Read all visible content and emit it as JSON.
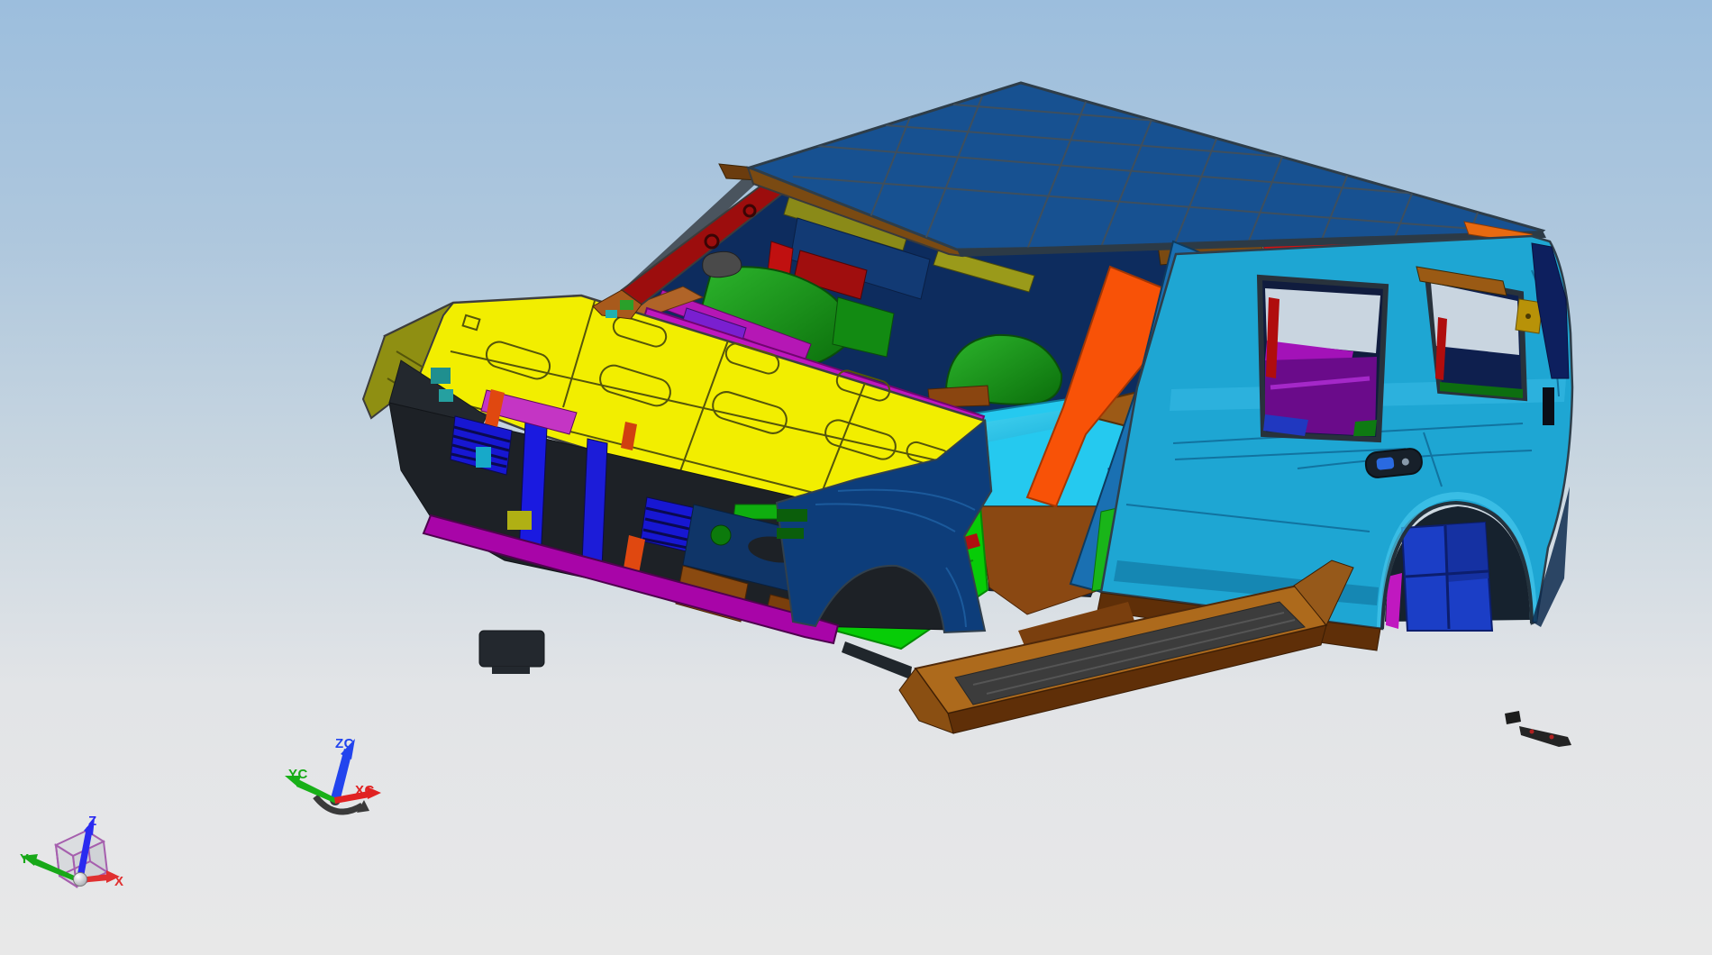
{
  "application": {
    "type": "cad-3d-viewport",
    "content": "Automotive body-in-white assembly shown in shaded view with per-part colors, isometric orientation"
  },
  "viewport": {
    "background_top": "#9cbedd",
    "background_middle": "#ccd8e1",
    "background_bottom": "#e8e8e8"
  },
  "wcs_triad": {
    "z": {
      "label": "ZC",
      "color": "#2244ee"
    },
    "y": {
      "label": "YC",
      "color": "#16a916"
    },
    "x": {
      "label": "XC",
      "color": "#e02222"
    },
    "handle_color": "#3a3a3a"
  },
  "absolute_triad": {
    "z": {
      "label": "Z",
      "color": "#2a2af0"
    },
    "y": {
      "label": "Y",
      "color": "#18a818"
    },
    "x": {
      "label": "X",
      "color": "#e03030"
    },
    "cube_edge_color": "#a65fae",
    "origin_ball_color": "#f0f0f4"
  },
  "model": {
    "assembly": "car-body-in-white",
    "palette": {
      "roof": "#175191",
      "hood": "#f2ee00",
      "body_side": "#1ea6d3",
      "header_rail": "#7a4a12",
      "running_board": "#ad6a1c",
      "floor_front": "#07cc07",
      "floor_mid": "#25c9ef",
      "floor_cargo": "#9c5a16",
      "front_fender_inner": "#0d3d7a",
      "grille": "#1717d2",
      "cowl_vent": "#bf16bf",
      "a_pillar_left": "#9c0d0d",
      "a_pillar_right": "#f85207",
      "b_pillar": "#1a70b2",
      "fender_edge_left": "#8f8f12",
      "bumper_rail": "#a805a8",
      "wheelhouse_green": "#1c9c1c",
      "arch_insert": "#1b3ec6",
      "window_glimpse": "#c9d5e0",
      "cargo_trim_purple": "#a312b8",
      "under_eave_red": "#d31111",
      "under_eave_cyan": "#29c3ef"
    },
    "parts": [
      {
        "name": "roof-panel",
        "color": "#175191"
      },
      {
        "name": "hood-panel",
        "color": "#f2ee00"
      },
      {
        "name": "body-side-outer",
        "color": "#1ea6d3"
      },
      {
        "name": "windshield-header-rail",
        "color": "#7a4a12"
      },
      {
        "name": "left-a-pillar-inner",
        "color": "#9c0d0d"
      },
      {
        "name": "right-a-pillar",
        "color": "#f85207"
      },
      {
        "name": "b-pillar-assembly",
        "color": "#1a70b2"
      },
      {
        "name": "front-floor-pan",
        "color": "#07cc07"
      },
      {
        "name": "mid-floor-pan",
        "color": "#25c9ef"
      },
      {
        "name": "cargo-floor",
        "color": "#9c5a16"
      },
      {
        "name": "front-fender-inner",
        "color": "#0d3d7a"
      },
      {
        "name": "grille-support",
        "color": "#1717d2"
      },
      {
        "name": "cowl-vent-panel",
        "color": "#bf16bf"
      },
      {
        "name": "bumper-lower-rail",
        "color": "#a805a8"
      },
      {
        "name": "running-board",
        "color": "#ad6a1c"
      },
      {
        "name": "left-fender-edge",
        "color": "#8f8f12"
      },
      {
        "name": "front-wheelhouse",
        "color": "#1c9c1c"
      },
      {
        "name": "rear-wheel-arch-insert",
        "color": "#1b3ec6"
      }
    ]
  }
}
